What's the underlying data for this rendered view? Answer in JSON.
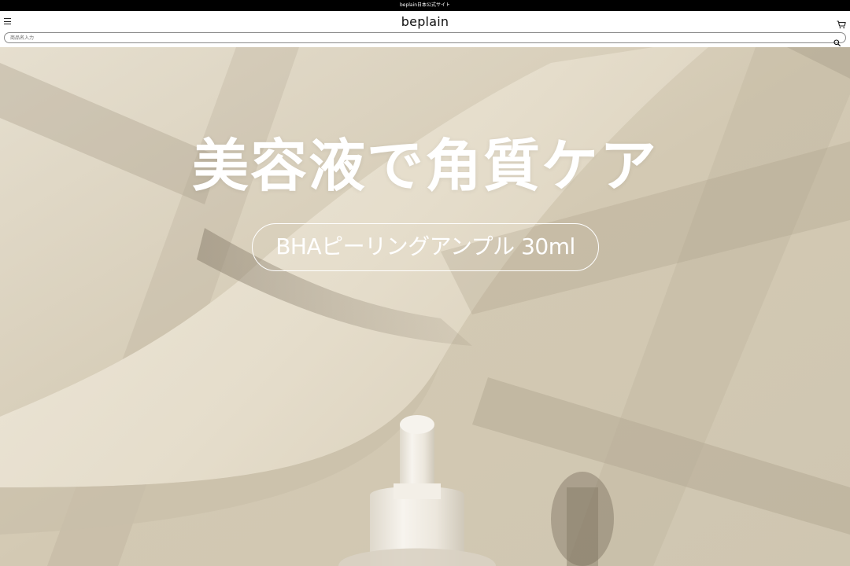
{
  "announcement": {
    "text": "beplain日本公式サイト"
  },
  "header": {
    "logo": "beplain",
    "menu_icon": "hamburger-menu-icon",
    "cart_icon": "shopping-cart-icon"
  },
  "search": {
    "placeholder": "商品名入力",
    "value": "",
    "icon": "search-icon"
  },
  "hero": {
    "heading": "美容液で角質ケア",
    "product_button": "BHAピーリングアンプル 30ml",
    "image_subject": "dropper-bottle"
  },
  "colors": {
    "topbar": "#000000",
    "header_bg": "#ffffff",
    "hero_beige": "#d4cbb6",
    "hero_text": "#ffffff"
  }
}
